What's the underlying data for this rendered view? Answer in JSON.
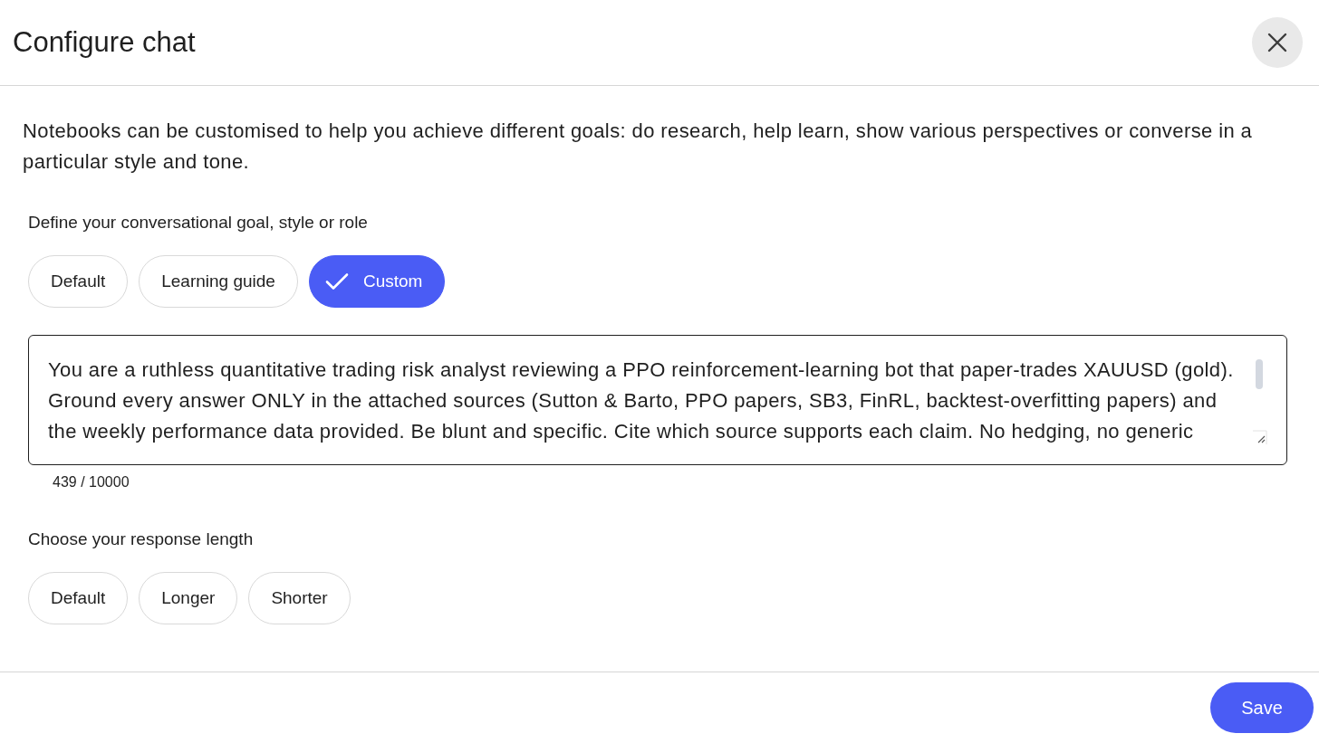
{
  "dialog": {
    "title": "Configure chat"
  },
  "description": "Notebooks can be customised to help you achieve different goals: do research, help learn, show various perspectives or converse in a particular style and tone.",
  "goal_section": {
    "label": "Define your conversational goal, style or role",
    "options": [
      {
        "label": "Default",
        "selected": false
      },
      {
        "label": "Learning guide",
        "selected": false
      },
      {
        "label": "Custom",
        "selected": true
      }
    ]
  },
  "custom_prompt": {
    "value": "You are a ruthless quantitative trading risk analyst reviewing a PPO reinforcement-learning bot that paper-trades XAUUSD (gold). Ground every answer ONLY in the attached sources (Sutton & Barto, PPO papers, SB3, FinRL, backtest-overfitting papers) and the weekly performance data provided. Be blunt and specific. Cite which source supports each claim. No hedging, no generic",
    "counter": "439 / 10000"
  },
  "length_section": {
    "label": "Choose your response length",
    "options": [
      {
        "label": "Default",
        "selected": false
      },
      {
        "label": "Longer",
        "selected": false
      },
      {
        "label": "Shorter",
        "selected": false
      }
    ]
  },
  "footer": {
    "save_button": "Save"
  }
}
